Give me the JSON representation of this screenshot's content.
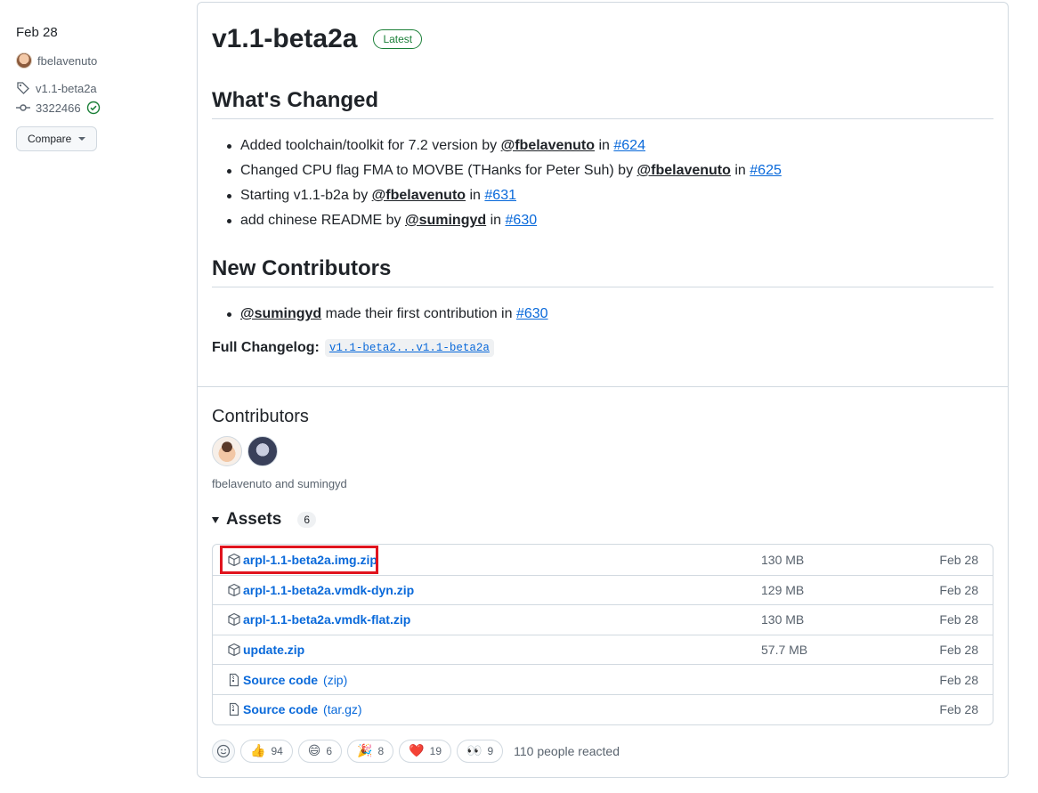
{
  "sidebar": {
    "date": "Feb 28",
    "author": "fbelavenuto",
    "tag": "v1.1-beta2a",
    "commit": "3322466",
    "compare_label": "Compare"
  },
  "release": {
    "title": "v1.1-beta2a",
    "badge": "Latest",
    "whats_changed": "What's Changed",
    "changes": [
      {
        "text": "Added toolchain/toolkit for 7.2 version by",
        "author": "@fbelavenuto",
        "in": "in",
        "pr": "#624"
      },
      {
        "text": "Changed CPU flag FMA to MOVBE (THanks for Peter Suh) by",
        "author": "@fbelavenuto",
        "in": "in",
        "pr": "#625"
      },
      {
        "text": "Starting v1.1-b2a by",
        "author": "@fbelavenuto",
        "in": "in",
        "pr": "#631"
      },
      {
        "text": "add chinese README by",
        "author": "@sumingyd",
        "in": "in",
        "pr": "#630"
      }
    ],
    "new_contributors": "New Contributors",
    "new_contrib_item": {
      "author": "@sumingyd",
      "text": "made their first contribution in",
      "pr": "#630"
    },
    "changelog_label": "Full Changelog:",
    "changelog_link": "v1.1-beta2...v1.1-beta2a"
  },
  "contributors": {
    "title": "Contributors",
    "names": "fbelavenuto and sumingyd"
  },
  "assets": {
    "title": "Assets",
    "count": "6",
    "items": [
      {
        "name": "arpl-1.1-beta2a.img.zip",
        "size": "130 MB",
        "date": "Feb 28",
        "icon": "package-icon"
      },
      {
        "name": "arpl-1.1-beta2a.vmdk-dyn.zip",
        "size": "129 MB",
        "date": "Feb 28",
        "icon": "package-icon"
      },
      {
        "name": "arpl-1.1-beta2a.vmdk-flat.zip",
        "size": "130 MB",
        "date": "Feb 28",
        "icon": "package-icon"
      },
      {
        "name": "update.zip",
        "size": "57.7 MB",
        "date": "Feb 28",
        "icon": "package-icon"
      },
      {
        "name": "Source code",
        "ext": "(zip)",
        "date": "Feb 28",
        "icon": "file-zip-icon"
      },
      {
        "name": "Source code",
        "ext": "(tar.gz)",
        "date": "Feb 28",
        "icon": "file-zip-icon"
      }
    ]
  },
  "reactions": {
    "items": [
      {
        "emoji": "👍",
        "count": "94"
      },
      {
        "emoji": "😄",
        "count": "6"
      },
      {
        "emoji": "🎉",
        "count": "8"
      },
      {
        "emoji": "❤️",
        "count": "19"
      },
      {
        "emoji": "👀",
        "count": "9"
      }
    ],
    "summary": "110 people reacted"
  },
  "colors": {
    "accent": "#0969da",
    "success": "#1a7f37",
    "highlight": "#e0141e"
  }
}
